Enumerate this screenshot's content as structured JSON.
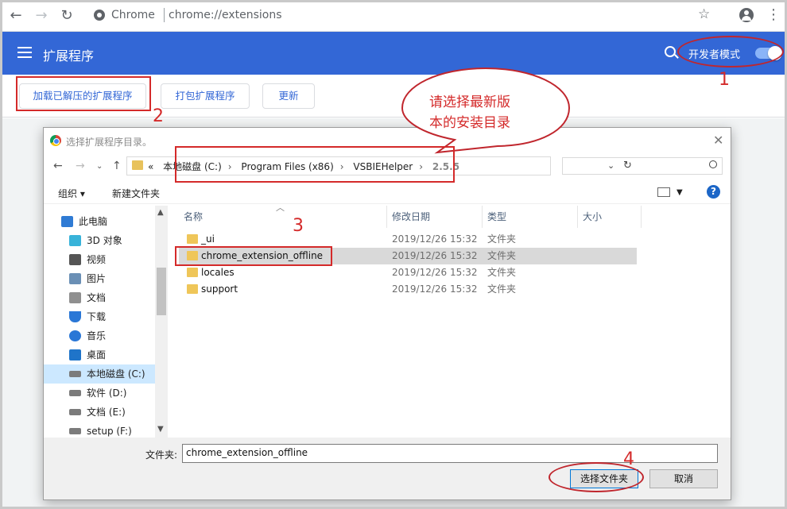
{
  "browser": {
    "site_name": "Chrome",
    "url": "chrome://extensions"
  },
  "extensions": {
    "title": "扩展程序",
    "dev_mode_label": "开发者模式",
    "dev_mode_on": true,
    "load_unpacked": "加载已解压的扩展程序",
    "pack": "打包扩展程序",
    "update": "更新",
    "accent_color": "#3367d6"
  },
  "annotations": {
    "n1": "1",
    "n2": "2",
    "n3": "3",
    "n4": "4",
    "bubble_line1": "请选择最新版",
    "bubble_line2": "本的安装目录",
    "color": "#d42a2a"
  },
  "dialog": {
    "title": "选择扩展程序目录。",
    "breadcrumbs": [
      "«",
      "本地磁盘 (C:)",
      "Program Files (x86)",
      "VSBIEHelper",
      "2.5.5"
    ],
    "organize": "组织 ▾",
    "new_folder": "新建文件夹",
    "nav_items": [
      {
        "label": "此电脑",
        "icon": "computer-icon"
      },
      {
        "label": "3D 对象",
        "icon": "3d-objects-icon"
      },
      {
        "label": "视频",
        "icon": "video-icon"
      },
      {
        "label": "图片",
        "icon": "pictures-icon"
      },
      {
        "label": "文档",
        "icon": "documents-icon"
      },
      {
        "label": "下载",
        "icon": "download-icon"
      },
      {
        "label": "音乐",
        "icon": "music-icon"
      },
      {
        "label": "桌面",
        "icon": "desktop-icon"
      },
      {
        "label": "本地磁盘 (C:)",
        "icon": "drive-icon"
      },
      {
        "label": "软件 (D:)",
        "icon": "drive-icon"
      },
      {
        "label": "文档 (E:)",
        "icon": "drive-icon"
      },
      {
        "label": "setup (F:)",
        "icon": "drive-icon"
      }
    ],
    "columns": [
      "名称",
      "修改日期",
      "类型",
      "大小"
    ],
    "files": [
      {
        "name": "_ui",
        "date": "2019/12/26 15:32",
        "type": "文件夹"
      },
      {
        "name": "chrome_extension_offline",
        "date": "2019/12/26 15:32",
        "type": "文件夹"
      },
      {
        "name": "locales",
        "date": "2019/12/26 15:32",
        "type": "文件夹"
      },
      {
        "name": "support",
        "date": "2019/12/26 15:32",
        "type": "文件夹"
      }
    ],
    "folder_label": "文件夹:",
    "folder_value": "chrome_extension_offline",
    "select_button": "选择文件夹",
    "cancel_button": "取消"
  }
}
